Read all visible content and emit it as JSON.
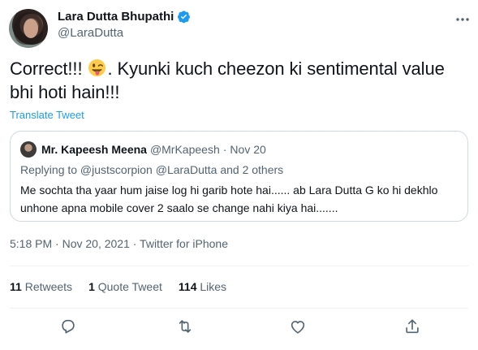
{
  "author": {
    "display_name": "Lara Dutta Bhupathi",
    "handle": "@LaraDutta",
    "verified": true
  },
  "tweet": {
    "text_before_emoji": "Correct!!! ",
    "emoji": "winking-face-with-tongue",
    "text_after_emoji": ". Kyunki kuch cheezon ki sentimental value bhi hoti hain!!!",
    "translate_label": "Translate Tweet"
  },
  "quoted_tweet": {
    "name": "Mr. Kapeesh Meena",
    "handle": "@MrKapeesh",
    "separator": "·",
    "date": "Nov 20",
    "replying_to": "Replying to @justscorpion @LaraDutta and 2 others",
    "text": "Me sochta tha yaar hum jaise log hi garib hote hai...... ab Lara Dutta G ko hi dekhlo unhone apna mobile cover 2 saalo se change nahi kiya hai......."
  },
  "meta": {
    "line": "5:18 PM · Nov 20, 2021 · Twitter for iPhone"
  },
  "stats": [
    {
      "count": "11",
      "label": "Retweets"
    },
    {
      "count": "1",
      "label": "Quote Tweet"
    },
    {
      "count": "114",
      "label": "Likes"
    }
  ],
  "actions": {
    "reply": "reply-icon",
    "retweet": "retweet-icon",
    "like": "heart-icon",
    "share": "share-icon"
  },
  "colors": {
    "accent": "#1d9bf0",
    "text": "#0f1419",
    "secondary": "#536471",
    "border": "#cfd9de"
  }
}
